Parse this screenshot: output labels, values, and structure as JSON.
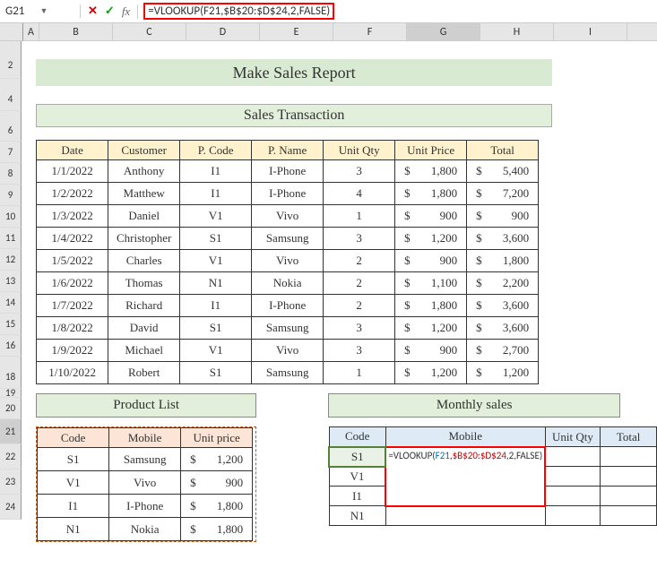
{
  "namebox": "G21",
  "formula": "=VLOOKUP(F21,$B$20:$D$24,2,FALSE)",
  "titles": {
    "main": "Make Sales Report",
    "sub": "Sales Transaction",
    "product": "Product List",
    "monthly": "Monthly sales"
  },
  "columns": [
    "A",
    "B",
    "C",
    "D",
    "E",
    "F",
    "G",
    "H",
    "I"
  ],
  "rows": [
    "2",
    "4",
    "6",
    "7",
    "8",
    "9",
    "10",
    "11",
    "12",
    "13",
    "14",
    "15",
    "16",
    "18",
    "19",
    "20",
    "21",
    "22",
    "23",
    "24"
  ],
  "salesHeaders": [
    "Date",
    "Customer",
    "P. Code",
    "P. Name",
    "Unit Qty",
    "Unit Price",
    "Total"
  ],
  "sales": [
    {
      "date": "1/1/2022",
      "customer": "Anthony",
      "code": "I1",
      "name": "I-Phone",
      "qty": "3",
      "price": "1,800",
      "total": "5,400"
    },
    {
      "date": "1/2/2022",
      "customer": "Matthew",
      "code": "I1",
      "name": "I-Phone",
      "qty": "4",
      "price": "1,800",
      "total": "7,200"
    },
    {
      "date": "1/3/2022",
      "customer": "Daniel",
      "code": "V1",
      "name": "Vivo",
      "qty": "1",
      "price": "900",
      "total": "900"
    },
    {
      "date": "1/4/2022",
      "customer": "Christopher",
      "code": "S1",
      "name": "Samsung",
      "qty": "3",
      "price": "1,200",
      "total": "3,600"
    },
    {
      "date": "1/5/2022",
      "customer": "Charles",
      "code": "V1",
      "name": "Vivo",
      "qty": "2",
      "price": "900",
      "total": "1,800"
    },
    {
      "date": "1/6/2022",
      "customer": "Thomas",
      "code": "N1",
      "name": "Nokia",
      "qty": "2",
      "price": "1,100",
      "total": "2,200"
    },
    {
      "date": "1/7/2022",
      "customer": "Richard",
      "code": "I1",
      "name": "I-Phone",
      "qty": "2",
      "price": "1,800",
      "total": "3,600"
    },
    {
      "date": "1/8/2022",
      "customer": "David",
      "code": "S1",
      "name": "Samsung",
      "qty": "3",
      "price": "1,200",
      "total": "3,600"
    },
    {
      "date": "1/9/2022",
      "customer": "Michael",
      "code": "V1",
      "name": "Vivo",
      "qty": "3",
      "price": "900",
      "total": "2,700"
    },
    {
      "date": "1/10/2022",
      "customer": "Robert",
      "code": "S1",
      "name": "Samsung",
      "qty": "1",
      "price": "1,200",
      "total": "1,200"
    }
  ],
  "productHeaders": [
    "Code",
    "Mobile",
    "Unit price"
  ],
  "products": [
    {
      "code": "S1",
      "mobile": "Samsung",
      "price": "1,200"
    },
    {
      "code": "V1",
      "mobile": "Vivo",
      "price": "900"
    },
    {
      "code": "I1",
      "mobile": "I-Phone",
      "price": "1,800"
    },
    {
      "code": "N1",
      "mobile": "Nokia",
      "price": "1,800"
    }
  ],
  "monthlyHeaders": [
    "Code",
    "Mobile",
    "Unit Qty",
    "Total"
  ],
  "monthly": [
    {
      "code": "S1"
    },
    {
      "code": "V1"
    },
    {
      "code": "I1"
    },
    {
      "code": "N1"
    }
  ],
  "editingFormula": {
    "p1": "=VLOOKUP(",
    "p2": "F21",
    "p3": ",",
    "p4": "$B$20:$D$24",
    "p5": ",",
    "p6": "2",
    "p7": ",FALSE)"
  },
  "cur": "$",
  "chart_data": {
    "type": "table",
    "title": "Make Sales Report",
    "series": [
      {
        "name": "Sales Transaction",
        "columns": [
          "Date",
          "Customer",
          "P. Code",
          "P. Name",
          "Unit Qty",
          "Unit Price",
          "Total"
        ],
        "rows": [
          [
            "1/1/2022",
            "Anthony",
            "I1",
            "I-Phone",
            3,
            1800,
            5400
          ],
          [
            "1/2/2022",
            "Matthew",
            "I1",
            "I-Phone",
            4,
            1800,
            7200
          ],
          [
            "1/3/2022",
            "Daniel",
            "V1",
            "Vivo",
            1,
            900,
            900
          ],
          [
            "1/4/2022",
            "Christopher",
            "S1",
            "Samsung",
            3,
            1200,
            3600
          ],
          [
            "1/5/2022",
            "Charles",
            "V1",
            "Vivo",
            2,
            900,
            1800
          ],
          [
            "1/6/2022",
            "Thomas",
            "N1",
            "Nokia",
            2,
            1100,
            2200
          ],
          [
            "1/7/2022",
            "Richard",
            "I1",
            "I-Phone",
            2,
            1800,
            3600
          ],
          [
            "1/8/2022",
            "David",
            "S1",
            "Samsung",
            3,
            1200,
            3600
          ],
          [
            "1/9/2022",
            "Michael",
            "V1",
            "Vivo",
            3,
            900,
            2700
          ],
          [
            "1/10/2022",
            "Robert",
            "S1",
            "Samsung",
            1,
            1200,
            1200
          ]
        ]
      },
      {
        "name": "Product List",
        "columns": [
          "Code",
          "Mobile",
          "Unit price"
        ],
        "rows": [
          [
            "S1",
            "Samsung",
            1200
          ],
          [
            "V1",
            "Vivo",
            900
          ],
          [
            "I1",
            "I-Phone",
            1800
          ],
          [
            "N1",
            "Nokia",
            1800
          ]
        ]
      },
      {
        "name": "Monthly sales",
        "columns": [
          "Code",
          "Mobile",
          "Unit Qty",
          "Total"
        ],
        "rows": [
          [
            "S1",
            "=VLOOKUP(F21,$B$20:$D$24,2,FALSE)",
            "",
            ""
          ],
          [
            "V1",
            "",
            "",
            ""
          ],
          [
            "I1",
            "",
            "",
            ""
          ],
          [
            "N1",
            "",
            "",
            ""
          ]
        ]
      }
    ]
  }
}
